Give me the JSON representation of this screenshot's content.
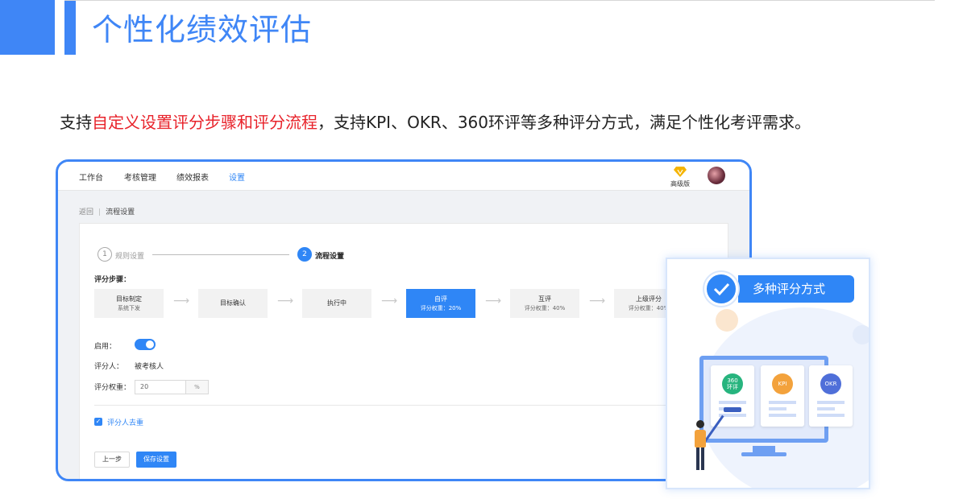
{
  "slide": {
    "title": "个性化绩效评估",
    "intro_prefix": "支持",
    "intro_highlight": "自定义设置评分步骤和评分流程",
    "intro_suffix": "，支持KPI、OKR、360环评等多种评分方式，满足个性化考评需求。"
  },
  "topnav": {
    "items": [
      "工作台",
      "考核管理",
      "绩效报表",
      "设置"
    ],
    "active": "设置",
    "vip_label": "高级版"
  },
  "breadcrumb": {
    "back": "返回",
    "current": "流程设置"
  },
  "steps": [
    {
      "num": "1",
      "label": "规则设置",
      "state": "done-inactive"
    },
    {
      "num": "2",
      "label": "流程设置",
      "state": "current"
    }
  ],
  "scoring_steps_label": "评分步骤：",
  "flow": [
    {
      "title": "目标制定",
      "sub": "系统下发",
      "active": false
    },
    {
      "title": "目标确认",
      "sub": "",
      "active": false
    },
    {
      "title": "执行中",
      "sub": "",
      "active": false
    },
    {
      "title": "自评",
      "sub": "评分权重：20%",
      "active": true
    },
    {
      "title": "互评",
      "sub": "评分权重：40%",
      "active": false
    },
    {
      "title": "上级评分",
      "sub": "评分权重：40%",
      "active": false
    }
  ],
  "form": {
    "enable_label": "启用：",
    "enabled": true,
    "rater_label": "评分人：",
    "rater_value": "被考核人",
    "weight_label": "评分权重：",
    "weight_value": "20",
    "weight_unit": "%",
    "dedupe_label": "评分人去重",
    "dedupe_checked": true
  },
  "buttons": {
    "prev": "上一步",
    "save": "保存设置"
  },
  "card": {
    "pill_label": "多种评分方式",
    "badges": [
      {
        "text": "360\n环评",
        "color": "#27b47e"
      },
      {
        "text": "KPI",
        "color": "#f3a23c"
      },
      {
        "text": "OKR",
        "color": "#4f6fd9"
      }
    ]
  },
  "colors": {
    "accent": "#3f86f6",
    "highlight": "#e8232b"
  }
}
